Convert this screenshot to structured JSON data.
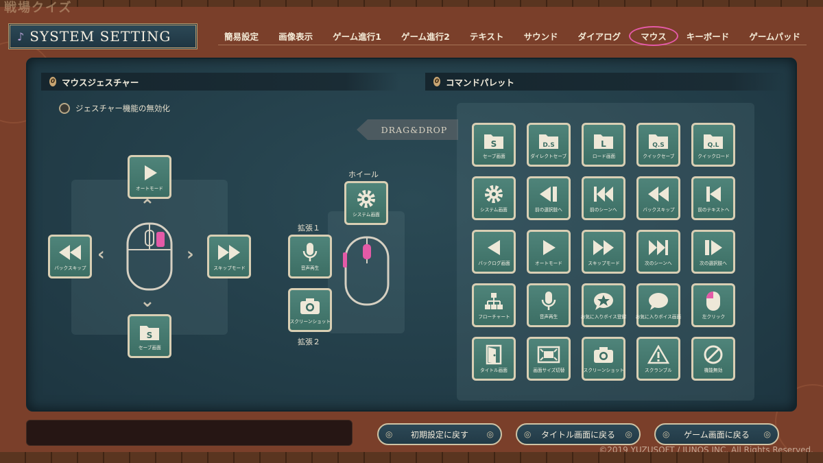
{
  "logo": "戦場クイズ",
  "title": "SYSTEM SETTING",
  "nav": [
    "簡易設定",
    "画像表示",
    "ゲーム進行1",
    "ゲーム進行2",
    "テキスト",
    "サウンド",
    "ダイアログ",
    "マウス",
    "キーボード",
    "ゲームパッド"
  ],
  "active_tab": "マウス",
  "gesture": {
    "heading": "マウスジェスチャー",
    "disable_label": "ジェスチャー機能の無効化",
    "up_label": "オートモード",
    "left_label": "バックスキップ",
    "right_label": "スキップモード",
    "down_label": "セーブ画面",
    "down_glyph": "S"
  },
  "buttons_area": {
    "wheel_caption": "ホイール",
    "wheel_label": "システム画面",
    "ext1_caption": "拡張１",
    "ext1_label": "音声再生",
    "ext2_caption": "拡張２",
    "ext2_label": "スクリーンショット"
  },
  "drag_drop": "DRAG&DROP",
  "palette": {
    "heading": "コマンドパレット",
    "rows": [
      [
        {
          "glyph": "S",
          "label": "セーブ画面",
          "icon": "folder-icon"
        },
        {
          "glyph": "D.S",
          "label": "ダイレクトセーブ",
          "icon": "folder-icon"
        },
        {
          "glyph": "L",
          "label": "ロード画面",
          "icon": "folder-icon"
        },
        {
          "glyph": "Q.S",
          "label": "クイックセーブ",
          "icon": "folder-icon"
        },
        {
          "glyph": "Q.L",
          "label": "クイックロード",
          "icon": "folder-icon"
        }
      ],
      [
        {
          "glyph": "",
          "label": "システム画面",
          "icon": "gear-icon"
        },
        {
          "glyph": "",
          "label": "前の選択肢へ",
          "icon": "prev-choice-icon"
        },
        {
          "glyph": "",
          "label": "前のシーンへ",
          "icon": "prev-scene-icon"
        },
        {
          "glyph": "",
          "label": "バックスキップ",
          "icon": "rewind-icon"
        },
        {
          "glyph": "",
          "label": "前のテキストへ",
          "icon": "prev-text-icon"
        }
      ],
      [
        {
          "glyph": "",
          "label": "バックログ画面",
          "icon": "back-icon"
        },
        {
          "glyph": "",
          "label": "オートモード",
          "icon": "play-icon"
        },
        {
          "glyph": "",
          "label": "スキップモード",
          "icon": "fast-forward-icon"
        },
        {
          "glyph": "",
          "label": "次のシーンへ",
          "icon": "next-scene-icon"
        },
        {
          "glyph": "",
          "label": "次の選択肢へ",
          "icon": "next-choice-icon"
        }
      ],
      [
        {
          "glyph": "",
          "label": "フローチャート",
          "icon": "flowchart-icon"
        },
        {
          "glyph": "",
          "label": "音声再生",
          "icon": "microphone-icon"
        },
        {
          "glyph": "",
          "label": "お気に入りボイス登録",
          "icon": "favorite-voice-icon"
        },
        {
          "glyph": "",
          "label": "お気に入りボイス画面",
          "icon": "speech-bubble-icon"
        },
        {
          "glyph": "",
          "label": "左クリック",
          "icon": "mouse-left-icon"
        }
      ],
      [
        {
          "glyph": "",
          "label": "タイトル画面",
          "icon": "door-icon"
        },
        {
          "glyph": "",
          "label": "画面サイズ切替",
          "icon": "resize-icon"
        },
        {
          "glyph": "",
          "label": "スクリーンショット",
          "icon": "camera-icon"
        },
        {
          "glyph": "",
          "label": "スクランブル",
          "icon": "warning-icon"
        },
        {
          "glyph": "",
          "label": "機能無効",
          "icon": "disable-icon"
        }
      ]
    ]
  },
  "footer": {
    "reset": "初期設定に戻す",
    "title_screen": "タイトル画面に戻る",
    "game_screen": "ゲーム画面に戻る",
    "copyright": "©2019 YUZUSOFT / JUNOS INC. All Rights Reserved."
  },
  "colors": {
    "accent_pink": "#e45aa7",
    "tile": "#4a7f75",
    "panel": "#243f4a"
  }
}
